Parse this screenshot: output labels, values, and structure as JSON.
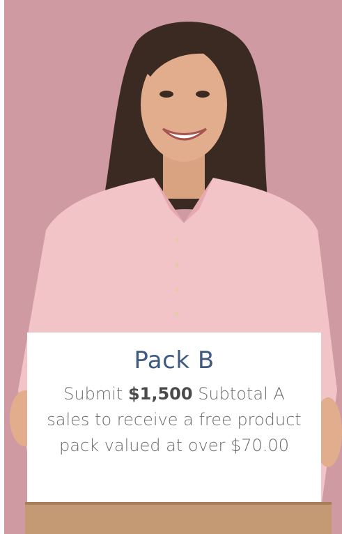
{
  "photo": {
    "subject": "woman-holding-box-icon",
    "background_color": "#cf9aa2"
  },
  "card": {
    "title": "Pack B",
    "desc_prefix": "Submit ",
    "desc_amount": "$1,500",
    "desc_suffix": " Subtotal A sales to receive a free product pack valued at over $70.00"
  },
  "colors": {
    "title": "#3f5a82",
    "body": "#6b6b6b",
    "card_bg": "#ffffff"
  }
}
